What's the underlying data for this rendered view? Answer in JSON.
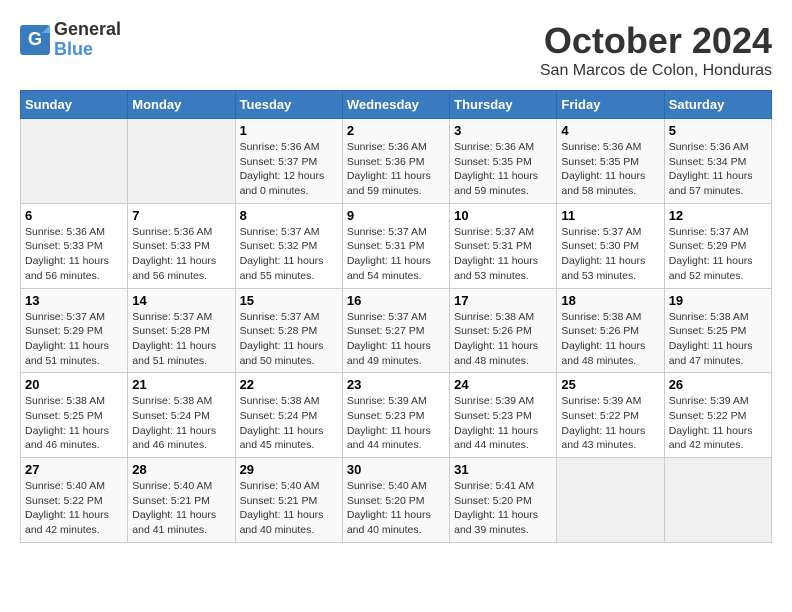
{
  "logo": {
    "general": "General",
    "blue": "Blue"
  },
  "title": "October 2024",
  "subtitle": "San Marcos de Colon, Honduras",
  "days_of_week": [
    "Sunday",
    "Monday",
    "Tuesday",
    "Wednesday",
    "Thursday",
    "Friday",
    "Saturday"
  ],
  "weeks": [
    [
      {
        "day": "",
        "info": ""
      },
      {
        "day": "",
        "info": ""
      },
      {
        "day": "1",
        "info": "Sunrise: 5:36 AM\nSunset: 5:37 PM\nDaylight: 12 hours\nand 0 minutes."
      },
      {
        "day": "2",
        "info": "Sunrise: 5:36 AM\nSunset: 5:36 PM\nDaylight: 11 hours\nand 59 minutes."
      },
      {
        "day": "3",
        "info": "Sunrise: 5:36 AM\nSunset: 5:35 PM\nDaylight: 11 hours\nand 59 minutes."
      },
      {
        "day": "4",
        "info": "Sunrise: 5:36 AM\nSunset: 5:35 PM\nDaylight: 11 hours\nand 58 minutes."
      },
      {
        "day": "5",
        "info": "Sunrise: 5:36 AM\nSunset: 5:34 PM\nDaylight: 11 hours\nand 57 minutes."
      }
    ],
    [
      {
        "day": "6",
        "info": "Sunrise: 5:36 AM\nSunset: 5:33 PM\nDaylight: 11 hours\nand 56 minutes."
      },
      {
        "day": "7",
        "info": "Sunrise: 5:36 AM\nSunset: 5:33 PM\nDaylight: 11 hours\nand 56 minutes."
      },
      {
        "day": "8",
        "info": "Sunrise: 5:37 AM\nSunset: 5:32 PM\nDaylight: 11 hours\nand 55 minutes."
      },
      {
        "day": "9",
        "info": "Sunrise: 5:37 AM\nSunset: 5:31 PM\nDaylight: 11 hours\nand 54 minutes."
      },
      {
        "day": "10",
        "info": "Sunrise: 5:37 AM\nSunset: 5:31 PM\nDaylight: 11 hours\nand 53 minutes."
      },
      {
        "day": "11",
        "info": "Sunrise: 5:37 AM\nSunset: 5:30 PM\nDaylight: 11 hours\nand 53 minutes."
      },
      {
        "day": "12",
        "info": "Sunrise: 5:37 AM\nSunset: 5:29 PM\nDaylight: 11 hours\nand 52 minutes."
      }
    ],
    [
      {
        "day": "13",
        "info": "Sunrise: 5:37 AM\nSunset: 5:29 PM\nDaylight: 11 hours\nand 51 minutes."
      },
      {
        "day": "14",
        "info": "Sunrise: 5:37 AM\nSunset: 5:28 PM\nDaylight: 11 hours\nand 51 minutes."
      },
      {
        "day": "15",
        "info": "Sunrise: 5:37 AM\nSunset: 5:28 PM\nDaylight: 11 hours\nand 50 minutes."
      },
      {
        "day": "16",
        "info": "Sunrise: 5:37 AM\nSunset: 5:27 PM\nDaylight: 11 hours\nand 49 minutes."
      },
      {
        "day": "17",
        "info": "Sunrise: 5:38 AM\nSunset: 5:26 PM\nDaylight: 11 hours\nand 48 minutes."
      },
      {
        "day": "18",
        "info": "Sunrise: 5:38 AM\nSunset: 5:26 PM\nDaylight: 11 hours\nand 48 minutes."
      },
      {
        "day": "19",
        "info": "Sunrise: 5:38 AM\nSunset: 5:25 PM\nDaylight: 11 hours\nand 47 minutes."
      }
    ],
    [
      {
        "day": "20",
        "info": "Sunrise: 5:38 AM\nSunset: 5:25 PM\nDaylight: 11 hours\nand 46 minutes."
      },
      {
        "day": "21",
        "info": "Sunrise: 5:38 AM\nSunset: 5:24 PM\nDaylight: 11 hours\nand 46 minutes."
      },
      {
        "day": "22",
        "info": "Sunrise: 5:38 AM\nSunset: 5:24 PM\nDaylight: 11 hours\nand 45 minutes."
      },
      {
        "day": "23",
        "info": "Sunrise: 5:39 AM\nSunset: 5:23 PM\nDaylight: 11 hours\nand 44 minutes."
      },
      {
        "day": "24",
        "info": "Sunrise: 5:39 AM\nSunset: 5:23 PM\nDaylight: 11 hours\nand 44 minutes."
      },
      {
        "day": "25",
        "info": "Sunrise: 5:39 AM\nSunset: 5:22 PM\nDaylight: 11 hours\nand 43 minutes."
      },
      {
        "day": "26",
        "info": "Sunrise: 5:39 AM\nSunset: 5:22 PM\nDaylight: 11 hours\nand 42 minutes."
      }
    ],
    [
      {
        "day": "27",
        "info": "Sunrise: 5:40 AM\nSunset: 5:22 PM\nDaylight: 11 hours\nand 42 minutes."
      },
      {
        "day": "28",
        "info": "Sunrise: 5:40 AM\nSunset: 5:21 PM\nDaylight: 11 hours\nand 41 minutes."
      },
      {
        "day": "29",
        "info": "Sunrise: 5:40 AM\nSunset: 5:21 PM\nDaylight: 11 hours\nand 40 minutes."
      },
      {
        "day": "30",
        "info": "Sunrise: 5:40 AM\nSunset: 5:20 PM\nDaylight: 11 hours\nand 40 minutes."
      },
      {
        "day": "31",
        "info": "Sunrise: 5:41 AM\nSunset: 5:20 PM\nDaylight: 11 hours\nand 39 minutes."
      },
      {
        "day": "",
        "info": ""
      },
      {
        "day": "",
        "info": ""
      }
    ]
  ]
}
